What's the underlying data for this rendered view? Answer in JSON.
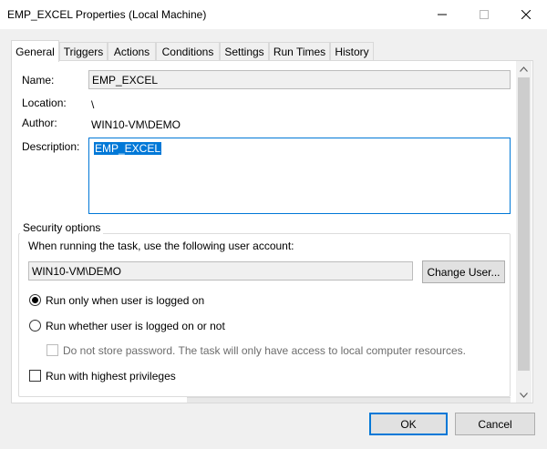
{
  "window": {
    "title": "EMP_EXCEL Properties (Local Machine)"
  },
  "tabs": [
    {
      "label": "General",
      "active": true
    },
    {
      "label": "Triggers"
    },
    {
      "label": "Actions"
    },
    {
      "label": "Conditions"
    },
    {
      "label": "Settings"
    },
    {
      "label": "Run Times"
    },
    {
      "label": "History"
    }
  ],
  "general": {
    "name_label": "Name:",
    "name_value": "EMP_EXCEL",
    "location_label": "Location:",
    "location_value": "\\",
    "author_label": "Author:",
    "author_value": "WIN10-VM\\DEMO",
    "description_label": "Description:",
    "description_value": "EMP_EXCEL"
  },
  "security": {
    "title": "Security options",
    "account_prompt": "When running the task, use the following user account:",
    "account_value": "WIN10-VM\\DEMO",
    "change_user_label": "Change User...",
    "radio_logged_on_label": "Run only when user is logged on",
    "radio_logged_on_checked": true,
    "radio_whether_label": "Run whether user is logged on or not",
    "radio_whether_checked": false,
    "no_store_password_label": "Do not store password.  The task will only have access to local computer resources.",
    "highest_privileges_label": "Run with highest privileges"
  },
  "footer": {
    "ok_label": "OK",
    "cancel_label": "Cancel"
  },
  "icons": {
    "minimize": "minimize-icon",
    "maximize": "maximize-icon",
    "close": "close-icon",
    "scroll_up": "chevron-up-icon",
    "scroll_down": "chevron-down-icon"
  },
  "colors": {
    "accent": "#0078d7",
    "window_bg": "#f0f0f0",
    "panel_bg": "#ffffff"
  }
}
